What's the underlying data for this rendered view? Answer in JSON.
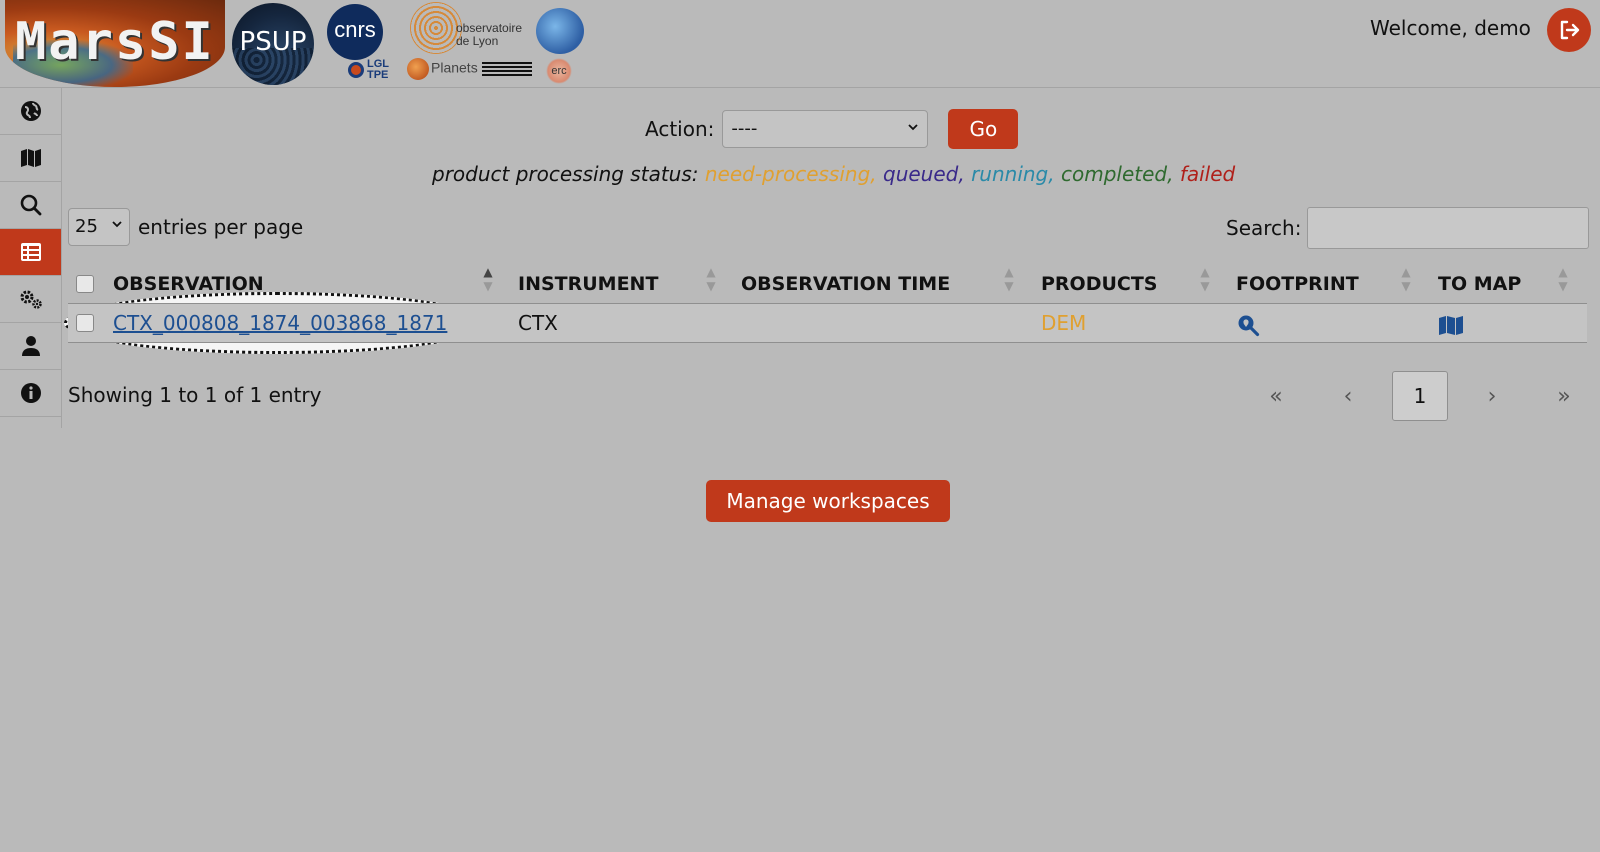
{
  "header": {
    "logos": {
      "marssi": "MarsSI",
      "psup": "PSUP",
      "cnrs": "cnrs",
      "lgl_line1": "LGL",
      "lgl_line2": "TPE",
      "observatoire_line1": "observatoire",
      "observatoire_line2": "de Lyon",
      "planets": "Planets",
      "erc": "erc"
    },
    "welcome": "Welcome, demo",
    "logout_icon": "logout-icon"
  },
  "sidebar": {
    "items": [
      {
        "icon": "globe-icon",
        "active": false
      },
      {
        "icon": "map-icon",
        "active": false
      },
      {
        "icon": "search-icon",
        "active": false
      },
      {
        "icon": "list-icon",
        "active": true
      },
      {
        "icon": "gears-icon",
        "active": false
      },
      {
        "icon": "user-icon",
        "active": false
      },
      {
        "icon": "info-icon",
        "active": false
      }
    ]
  },
  "action": {
    "label": "Action:",
    "selected": "----",
    "go_label": "Go"
  },
  "status": {
    "prefix": "product processing status:",
    "need_processing": "need-processing,",
    "queued": "queued,",
    "running": "running,",
    "completed": "completed,",
    "failed": "failed"
  },
  "entries": {
    "value": "25",
    "label": "entries per page"
  },
  "search": {
    "label": "Search:",
    "value": ""
  },
  "table": {
    "columns": [
      "OBSERVATION",
      "INSTRUMENT",
      "OBSERVATION TIME",
      "PRODUCTS",
      "FOOTPRINT",
      "TO MAP"
    ],
    "rows": [
      {
        "observation": "CTX_000808_1874_003868_1871",
        "instrument": "CTX",
        "observation_time": "",
        "products": "DEM",
        "footprint_icon": "search-location-icon",
        "to_map_icon": "map-icon"
      }
    ]
  },
  "footer": {
    "showing": "Showing 1 to 1 of 1 entry",
    "pager": {
      "first": "«",
      "prev": "‹",
      "current": "1",
      "next": "›",
      "last": "»"
    }
  },
  "manage_label": "Manage workspaces",
  "colors": {
    "accent": "#c0391b",
    "link": "#1d4f91",
    "need_processing": "#e0a030",
    "queued": "#3a2a8a",
    "running": "#2a8aa8",
    "completed": "#2f6a2f",
    "failed": "#b0201a"
  }
}
